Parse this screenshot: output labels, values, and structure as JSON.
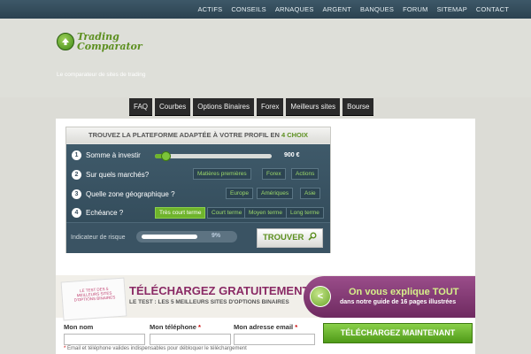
{
  "topnav": {
    "items": [
      "ACTIFS",
      "CONSEILS",
      "ARNAQUES",
      "ARGENT",
      "BANQUES",
      "FORUM",
      "SITEMAP",
      "CONTACT"
    ]
  },
  "header": {
    "logo_line1": "Trading",
    "logo_line2": "Comparator",
    "tagline": "Le comparateur de sites de trading"
  },
  "mainnav": {
    "items": [
      "FAQ",
      "Courbes",
      "Options Binaires",
      "Forex",
      "Meilleurs sites",
      "Bourse"
    ]
  },
  "finder": {
    "title_prefix": "TROUVEZ LA PLATEFORME ADAPTÉE À VOTRE PROFIL EN ",
    "title_highlight": "4 CHOIX",
    "q1": {
      "num": "1",
      "label": "Somme à investir",
      "amount": "900 €",
      "slider_fraction": 0.05
    },
    "q2": {
      "num": "2",
      "label": "Sur quels marchés?",
      "options": [
        "Matières premières",
        "Forex",
        "Actions"
      ]
    },
    "q3": {
      "num": "3",
      "label": "Quelle zone géographique ?",
      "options": [
        "Europe",
        "Amériques",
        "Asie"
      ]
    },
    "q4": {
      "num": "4",
      "label": "Echéance ?",
      "options": [
        "Très court terme",
        "Court terme",
        "Moyen terme",
        "Long terme"
      ],
      "active_index": 0
    },
    "risk": {
      "label": "Indicateur de risque",
      "value": "9%",
      "fraction": 0.09
    },
    "find_button": "TROUVER"
  },
  "promo": {
    "book_title": "LE TEST DES 5 MEILLEURS SITES D'OPTIONS BINAIRES",
    "headline": "TÉLÉCHARGEZ GRATUITEMENT",
    "subline": "LE TEST : LES 5 MEILLEURS SITES D'OPTIONS BINAIRES",
    "pill_arrow": "<",
    "pill_headline": "On vous explique TOUT",
    "pill_subline": "dans notre guide de 16 pages illustrées"
  },
  "form": {
    "name_label": "Mon nom",
    "phone_label": "Mon téléphone",
    "email_label": "Mon adresse email",
    "required_mark": "*",
    "download_button": "TÉLÉCHARGEZ MAINTENANT",
    "note": "Email et téléphone valides indispensables pour débloquer le téléchargement"
  },
  "colors": {
    "accent_green": "#5c8f1f",
    "promo_purple": "#8a2a65",
    "nav_dark": "#2a2a2a"
  }
}
